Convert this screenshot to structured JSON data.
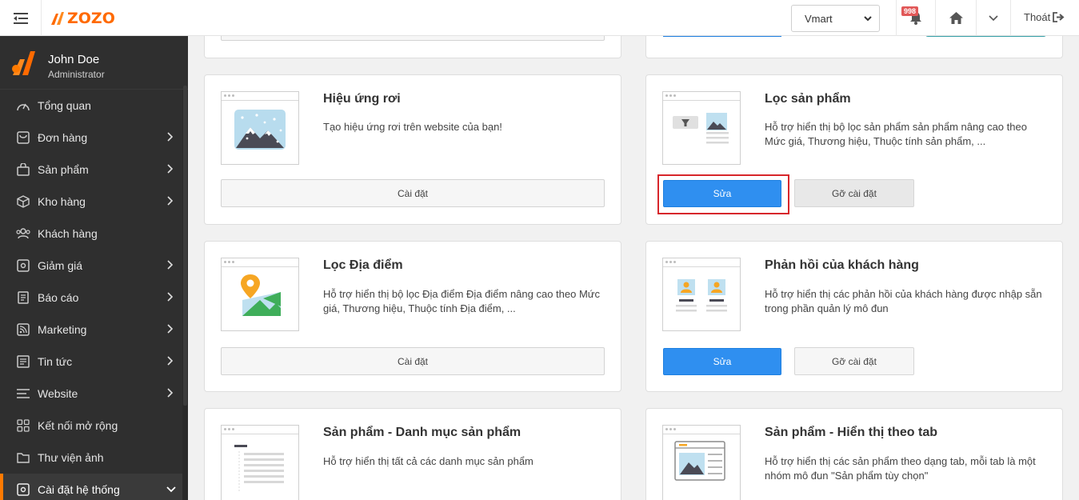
{
  "topbar": {
    "logo_text": "ZOZO",
    "store_selected": "Vmart",
    "notification_count": "998",
    "logout_label": "Thoát",
    "brand_color": "#ff6a00"
  },
  "profile": {
    "name": "John Doe",
    "role": "Administrator"
  },
  "sidebar": {
    "items": [
      {
        "label": "Tổng quan",
        "icon": "tachometer-icon",
        "has_children": false
      },
      {
        "label": "Đơn hàng",
        "icon": "order-icon",
        "has_children": true
      },
      {
        "label": "Sản phẩm",
        "icon": "bag-icon",
        "has_children": true
      },
      {
        "label": "Kho hàng",
        "icon": "box-icon",
        "has_children": true
      },
      {
        "label": "Khách hàng",
        "icon": "users-icon",
        "has_children": false
      },
      {
        "label": "Giảm giá",
        "icon": "discount-icon",
        "has_children": true
      },
      {
        "label": "Báo cáo",
        "icon": "report-icon",
        "has_children": true
      },
      {
        "label": "Marketing",
        "icon": "rss-icon",
        "has_children": true
      },
      {
        "label": "Tin tức",
        "icon": "news-icon",
        "has_children": true
      },
      {
        "label": "Website",
        "icon": "list-icon",
        "has_children": true
      },
      {
        "label": "Kết nối mở rộng",
        "icon": "grid-icon",
        "has_children": false
      },
      {
        "label": "Thư viện ảnh",
        "icon": "folder-icon",
        "has_children": false
      },
      {
        "label": "Cài đặt hệ thống",
        "icon": "settings-icon",
        "has_children": true,
        "active": true
      }
    ]
  },
  "modules": [
    {
      "title": "Hiệu ứng rơi",
      "description": "Tạo hiệu ứng rơi trên website của bạn!",
      "action": "Cài đặt"
    },
    {
      "title": "Lọc sản phẩm",
      "description": "Hỗ trợ hiển thị bộ lọc sản phẩm sản phẩm nâng cao theo Mức giá, Thương hiệu, Thuộc tính sản phẩm, ...",
      "edit_label": "Sửa",
      "uninstall_label": "Gỡ cài đặt"
    },
    {
      "title": "Lọc Địa điểm",
      "description": "Hỗ trợ hiển thị bộ lọc Địa điểm Địa điểm nâng cao theo Mức giá, Thương hiệu, Thuộc tính Địa điểm, ...",
      "action": "Cài đặt"
    },
    {
      "title": "Phản hồi của khách hàng",
      "description": "Hỗ trợ hiển thị các phản hồi của khách hàng được nhập sẵn trong phần quản lý mô đun",
      "edit_label": "Sửa",
      "uninstall_label": "Gỡ cài đặt"
    },
    {
      "title": "Sản phẩm - Danh mục sản phẩm",
      "description": "Hỗ trợ hiển thị tất cả các danh mục sản phẩm"
    },
    {
      "title": "Sản phẩm - Hiển thị theo tab",
      "description": "Hỗ trợ hiển thị các sản phẩm theo dạng tab, mỗi tab là một nhóm mô đun \"Sản phẩm tùy chọn\""
    }
  ]
}
